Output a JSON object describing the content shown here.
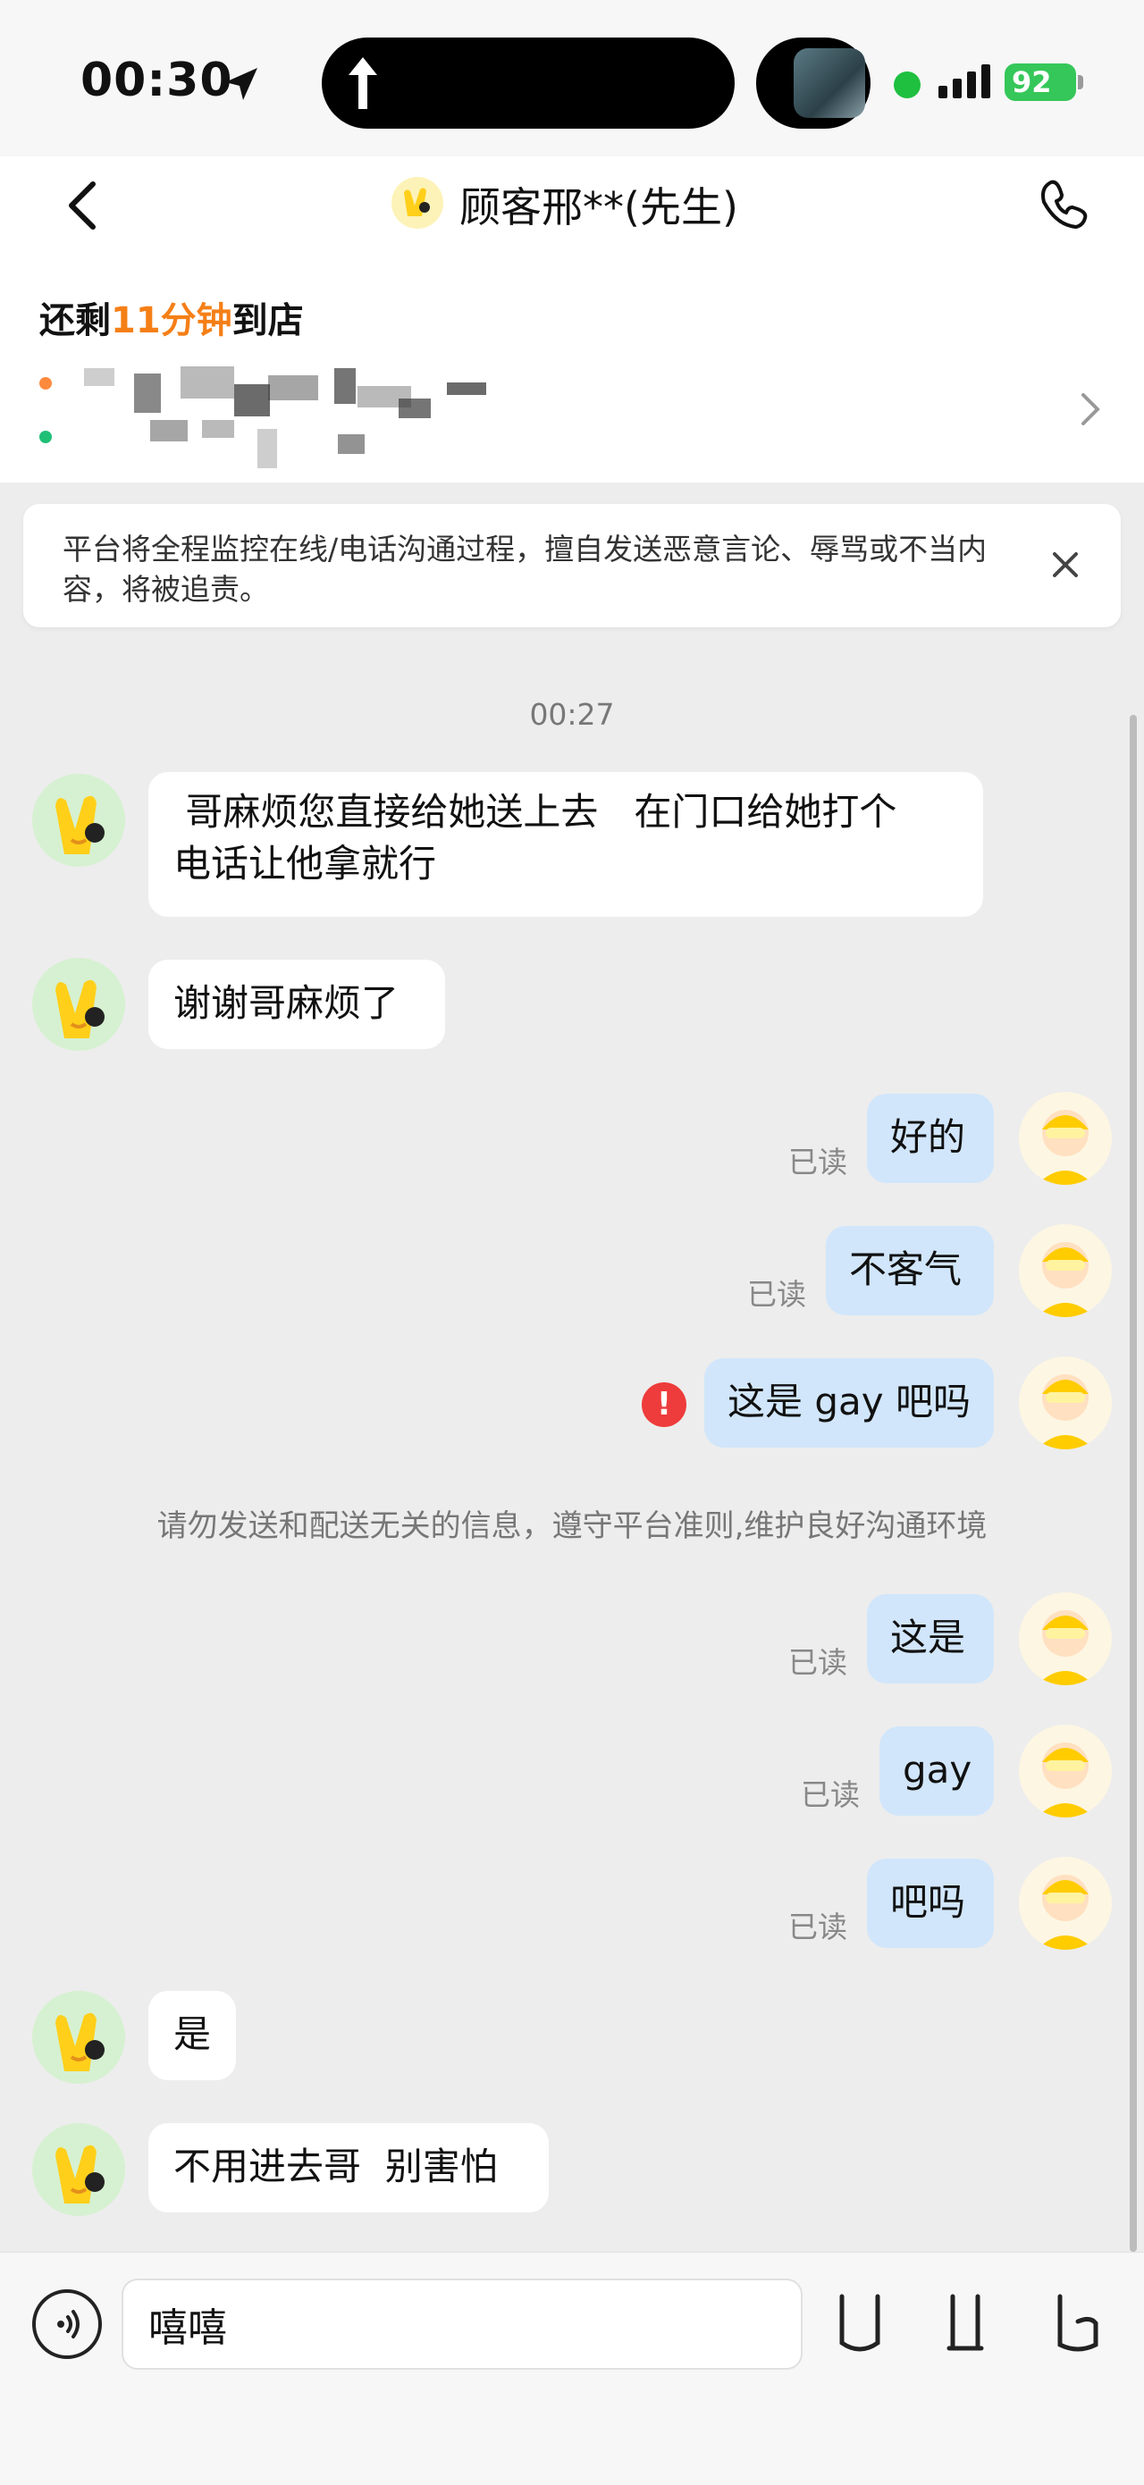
{
  "status_bar": {
    "time": "00:30",
    "battery": "92"
  },
  "header": {
    "title": "顾客邢**(先生)",
    "back_icon": "chevron-left-icon",
    "call_icon": "phone-icon"
  },
  "order": {
    "eta_prefix": "还剩",
    "eta_minutes": "11分钟",
    "eta_suffix": "到店"
  },
  "notice": {
    "text": "平台将全程监控在线/电话沟通过程，擅自发送恶意言论、辱骂或不当内容，将被追责。"
  },
  "chat": {
    "timestamp": "00:27",
    "read_label": "已读",
    "system_tip": "请勿发送和配送无关的信息，遵守平台准则,维护良好沟通环境",
    "messages": [
      {
        "side": "in",
        "text": " 哥麻烦您直接给她送上去   在门口给她打个\n电话让他拿就行"
      },
      {
        "side": "in",
        "text": "谢谢哥麻烦了"
      },
      {
        "side": "out",
        "text": "好的",
        "status": "已读"
      },
      {
        "side": "out",
        "text": "不客气",
        "status": "已读"
      },
      {
        "side": "out",
        "text": "这是 gay 吧吗",
        "status": "failed"
      },
      {
        "side": "out",
        "text": "这是",
        "status": "已读"
      },
      {
        "side": "out",
        "text": "gay",
        "status": "已读"
      },
      {
        "side": "out",
        "text": "吧吗",
        "status": "已读"
      },
      {
        "side": "in",
        "text": "是"
      },
      {
        "side": "in",
        "text": "不用进去哥  别害怕"
      }
    ]
  },
  "input": {
    "value": "嘻嘻"
  },
  "colors": {
    "accent_orange": "#f57f17",
    "outgoing_bubble": "#d1e6fb",
    "error_red": "#ee3b3b",
    "battery_green": "#35c759"
  }
}
